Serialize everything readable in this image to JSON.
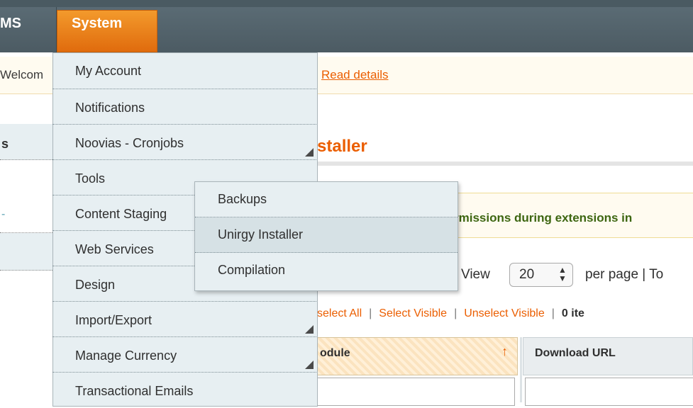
{
  "colors": {
    "accent_orange": "#eb5e00",
    "menu_bg": "#e7eff2",
    "nav_bg": "#4c5b63",
    "success_text": "#3d6611"
  },
  "nav": {
    "cms_label": "MS",
    "system_label": "System"
  },
  "notice": {
    "text": "Welcom",
    "link": "Read details"
  },
  "left": {
    "tab1": "s",
    "tab2": "-"
  },
  "page": {
    "title": "staller"
  },
  "warning": {
    "text": "rmissions during extensions in"
  },
  "pager": {
    "view_label": "View",
    "per_page_value": "20",
    "per_page_label": "per page  |  To"
  },
  "mass_actions": {
    "unselect_all": "select All",
    "select_visible": "Select Visible",
    "unselect_visible": "Unselect Visible",
    "items": "0 ite",
    "sep": "|"
  },
  "grid": {
    "module_header": "odule",
    "sort_icon": "↑",
    "url_header": "Download URL"
  },
  "menu": {
    "items": [
      {
        "label": "My Account"
      },
      {
        "label": "Notifications"
      },
      {
        "label": "Noovias - Cronjobs"
      },
      {
        "label": "Tools"
      },
      {
        "label": "Content Staging"
      },
      {
        "label": "Web Services"
      },
      {
        "label": "Design"
      },
      {
        "label": "Import/Export"
      },
      {
        "label": "Manage Currency"
      },
      {
        "label": "Transactional Emails"
      }
    ]
  },
  "submenu": {
    "items": [
      {
        "label": "Backups"
      },
      {
        "label": "Unirgy Installer"
      },
      {
        "label": "Compilation"
      }
    ]
  }
}
